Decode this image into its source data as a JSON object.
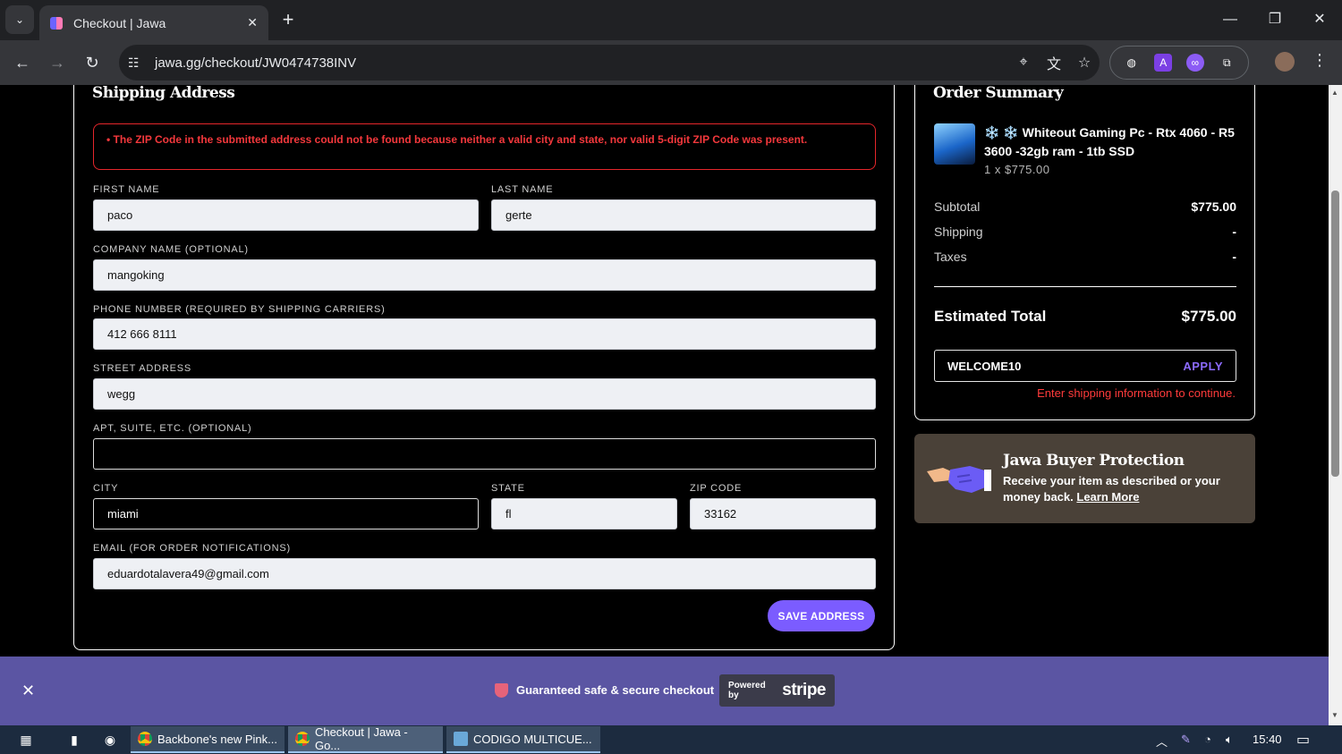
{
  "browser": {
    "tab_title": "Checkout | Jawa",
    "url": "jawa.gg/checkout/JW0474738INV"
  },
  "shipping": {
    "title": "Shipping Address",
    "error": "• The ZIP Code in the submitted address could not be found because neither a valid city and state, nor valid 5-digit ZIP Code was present.",
    "fields": {
      "first_name": {
        "label": "FIRST NAME",
        "value": "paco"
      },
      "last_name": {
        "label": "LAST NAME",
        "value": "gerte"
      },
      "company": {
        "label": "COMPANY NAME (OPTIONAL)",
        "value": "mangoking"
      },
      "phone": {
        "label": "PHONE NUMBER (REQUIRED BY SHIPPING CARRIERS)",
        "value": "412 666 8111"
      },
      "street": {
        "label": "STREET ADDRESS",
        "value": "wegg"
      },
      "apt": {
        "label": "APT, SUITE, ETC. (OPTIONAL)",
        "value": ""
      },
      "city": {
        "label": "CITY",
        "value": "miami"
      },
      "state": {
        "label": "STATE",
        "value": "fl"
      },
      "zip": {
        "label": "ZIP CODE",
        "value": "33162"
      },
      "email": {
        "label": "EMAIL (FOR ORDER NOTIFICATIONS)",
        "value": "eduardotalavera49@gmail.com"
      }
    },
    "save_label": "SAVE ADDRESS"
  },
  "order": {
    "title": "Order Summary",
    "item_name": "❄️ ❄️ Whiteout Gaming Pc - Rtx 4060 - R5 3600 -32gb ram - 1tb SSD",
    "item_qty": "1 x  $775.00",
    "subtotal_label": "Subtotal",
    "subtotal_value": "$775.00",
    "shipping_label": "Shipping",
    "shipping_value": "-",
    "taxes_label": "Taxes",
    "taxes_value": "-",
    "total_label": "Estimated Total",
    "total_value": "$775.00",
    "promo_code": "WELCOME10",
    "apply_label": "APPLY",
    "promo_error": "Enter shipping information to continue."
  },
  "protection": {
    "title": "Jawa Buyer Protection",
    "text": "Receive your item as described or your money back.",
    "link": "Learn More"
  },
  "footer": {
    "secure_text": "Guaranteed safe & secure checkout",
    "powered_by": "Powered by",
    "stripe": "stripe"
  },
  "taskbar": {
    "items": [
      "Backbone's new Pink...",
      "Checkout | Jawa - Go...",
      "CODIGO MULTICUE..."
    ],
    "clock": "15:40"
  }
}
